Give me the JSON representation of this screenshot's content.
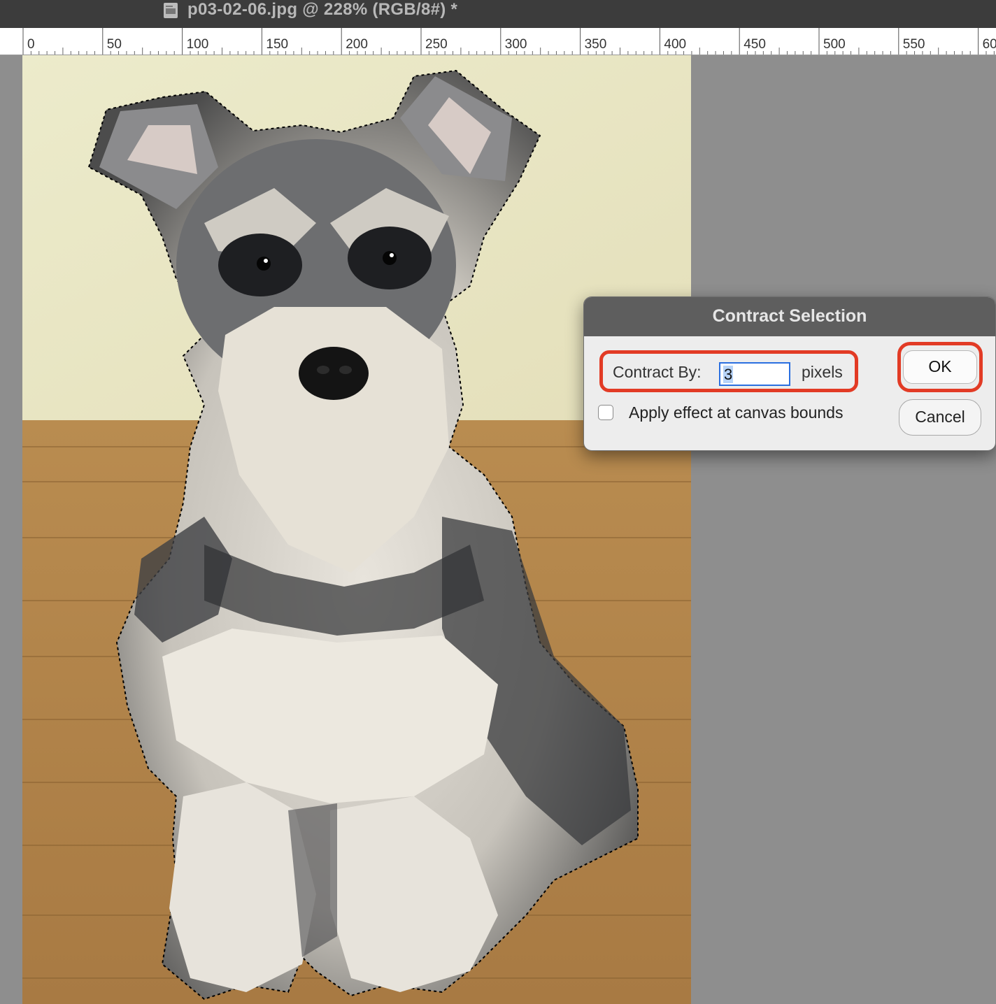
{
  "window": {
    "title": "p03-02-06.jpg @ 228% (RGB/8#) *"
  },
  "ruler": {
    "labels": [
      "0",
      "50",
      "100",
      "150",
      "200",
      "250",
      "300",
      "350",
      "400",
      "450",
      "500",
      "550",
      "60"
    ]
  },
  "dialog": {
    "title": "Contract Selection",
    "contract_label": "Contract By:",
    "contract_value": "3",
    "unit": "pixels",
    "checkbox_label": "Apply effect at canvas bounds",
    "checkbox_checked": false,
    "ok_label": "OK",
    "cancel_label": "Cancel",
    "highlight_color": "#e23b25",
    "focus_color": "#2a6fe0"
  },
  "icons": {
    "document": "document-icon"
  }
}
